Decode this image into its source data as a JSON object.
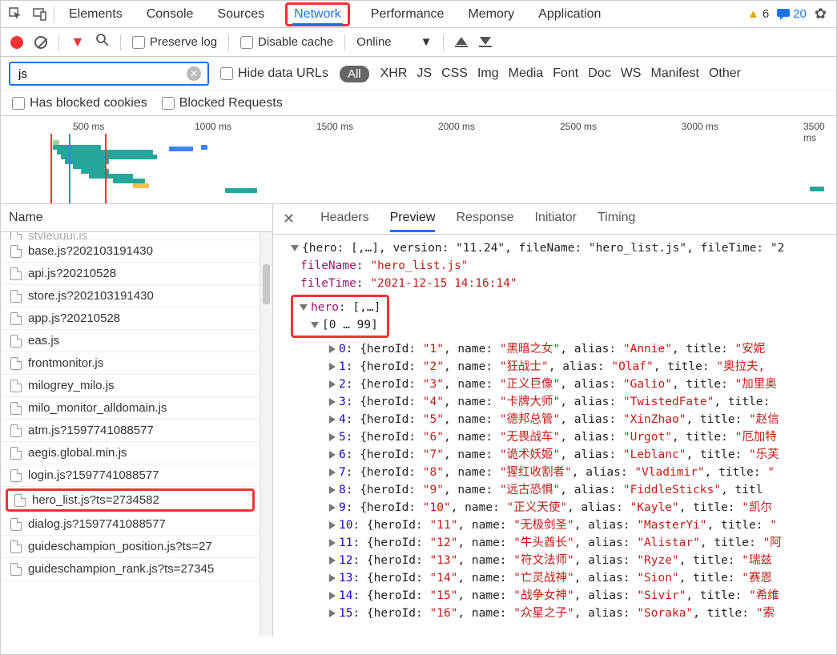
{
  "topTabs": [
    "Elements",
    "Console",
    "Sources",
    "Network",
    "Performance",
    "Memory",
    "Application"
  ],
  "activeTopTab": "Network",
  "warnings": "6",
  "messages": "20",
  "preserveLog": "Preserve log",
  "disableCache": "Disable cache",
  "throttling": "Online",
  "filterValue": "js",
  "hideDataURLs": "Hide data URLs",
  "typeAll": "All",
  "types": [
    "XHR",
    "JS",
    "CSS",
    "Img",
    "Media",
    "Font",
    "Doc",
    "WS",
    "Manifest",
    "Other"
  ],
  "hasBlockedCookies": "Has blocked cookies",
  "blockedRequests": "Blocked Requests",
  "timeTicks": [
    "500 ms",
    "1000 ms",
    "1500 ms",
    "2000 ms",
    "2500 ms",
    "3000 ms",
    "3500 ms"
  ],
  "nameHeader": "Name",
  "files": [
    {
      "n": "styleuuui.js",
      "cut": true
    },
    {
      "n": "base.js?202103191430"
    },
    {
      "n": "api.js?20210528"
    },
    {
      "n": "store.js?202103191430"
    },
    {
      "n": "app.js?20210528"
    },
    {
      "n": "eas.js"
    },
    {
      "n": "frontmonitor.js"
    },
    {
      "n": "milogrey_milo.js"
    },
    {
      "n": "milo_monitor_alldomain.js"
    },
    {
      "n": "atm.js?1597741088577"
    },
    {
      "n": "aegis.global.min.js"
    },
    {
      "n": "login.js?1597741088577"
    },
    {
      "n": "hero_list.js?ts=2734582",
      "sel": true
    },
    {
      "n": "dialog.js?1597741088577"
    },
    {
      "n": "guideschampion_position.js?ts=27"
    },
    {
      "n": "guideschampion_rank.js?ts=27345"
    }
  ],
  "rightTabs": [
    "Headers",
    "Preview",
    "Response",
    "Initiator",
    "Timing"
  ],
  "activeRightTab": "Preview",
  "json": {
    "topLine": "{hero: [,…], version: \"11.24\", fileName: \"hero_list.js\", fileTime: \"2",
    "fileNameKey": "fileName",
    "fileNameVal": "\"hero_list.js\"",
    "fileTimeKey": "fileTime",
    "fileTimeVal": "\"2021-12-15 14:16:14\"",
    "heroKey": "hero",
    "heroVal": "[,…]",
    "rangeLabel": "[0 … 99]",
    "rows": [
      {
        "i": "0",
        "id": "\"1\"",
        "name": "\"黑暗之女\"",
        "alias": "\"Annie\"",
        "title": "\"安妮"
      },
      {
        "i": "1",
        "id": "\"2\"",
        "name": "\"狂战士\"",
        "alias": "\"Olaf\"",
        "title": "\"奥拉夫,"
      },
      {
        "i": "2",
        "id": "\"3\"",
        "name": "\"正义巨像\"",
        "alias": "\"Galio\"",
        "title": "\"加里奥"
      },
      {
        "i": "3",
        "id": "\"4\"",
        "name": "\"卡牌大师\"",
        "alias": "\"TwistedFate\"",
        "title": ""
      },
      {
        "i": "4",
        "id": "\"5\"",
        "name": "\"德邦总管\"",
        "alias": "\"XinZhao\"",
        "title": "\"赵信"
      },
      {
        "i": "5",
        "id": "\"6\"",
        "name": "\"无畏战车\"",
        "alias": "\"Urgot\"",
        "title": "\"厄加特"
      },
      {
        "i": "6",
        "id": "\"7\"",
        "name": "\"诡术妖姬\"",
        "alias": "\"Leblanc\"",
        "title": "\"乐芙"
      },
      {
        "i": "7",
        "id": "\"8\"",
        "name": "\"猩红收割者\"",
        "alias": "\"Vladimir\"",
        "title": "\""
      },
      {
        "i": "8",
        "id": "\"9\"",
        "name": "\"远古恐惧\"",
        "alias": "\"FiddleSticks\"",
        "titleKey": "titl"
      },
      {
        "i": "9",
        "id": "\"10\"",
        "name": "\"正义天使\"",
        "alias": "\"Kayle\"",
        "title": "\"凯尔"
      },
      {
        "i": "10",
        "id": "\"11\"",
        "name": "\"无极剑圣\"",
        "alias": "\"MasterYi\"",
        "title": "\""
      },
      {
        "i": "11",
        "id": "\"12\"",
        "name": "\"牛头酋长\"",
        "alias": "\"Alistar\"",
        "title": "\"阿"
      },
      {
        "i": "12",
        "id": "\"13\"",
        "name": "\"符文法师\"",
        "alias": "\"Ryze\"",
        "title": "\"瑞兹"
      },
      {
        "i": "13",
        "id": "\"14\"",
        "name": "\"亡灵战神\"",
        "alias": "\"Sion\"",
        "title": "\"赛恩"
      },
      {
        "i": "14",
        "id": "\"15\"",
        "name": "\"战争女神\"",
        "alias": "\"Sivir\"",
        "title": "\"希维"
      },
      {
        "i": "15",
        "id": "\"16\"",
        "name": "\"众星之子\"",
        "alias": "\"Soraka\"",
        "title": "\"索"
      }
    ]
  }
}
